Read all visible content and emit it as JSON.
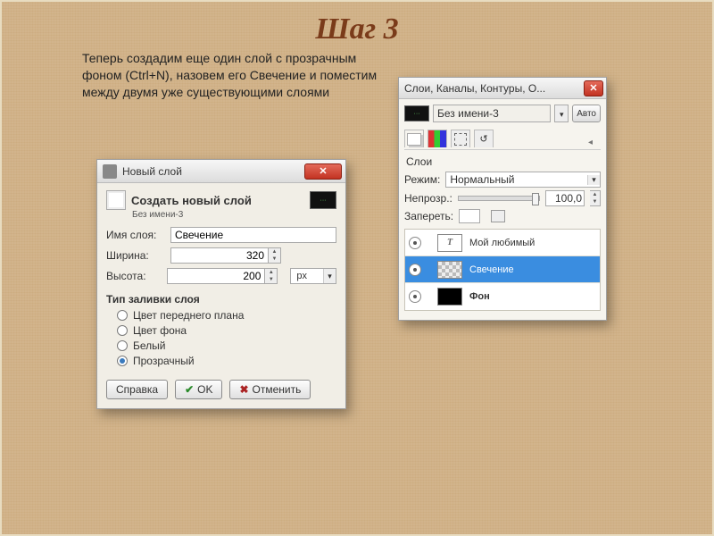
{
  "page": {
    "title": "Шаг 3",
    "instructions": "Теперь создадим еще один слой с прозрачным фоном  (Ctrl+N), назовем его Свечение и  поместим между двумя уже существующими слоями"
  },
  "newLayerDialog": {
    "windowTitle": "Новый слой",
    "heading": "Создать новый слой",
    "imageName": "Без имени-3",
    "labels": {
      "name": "Имя слоя:",
      "width": "Ширина:",
      "height": "Высота:",
      "unit": "px"
    },
    "values": {
      "name": "Свечение",
      "width": "320",
      "height": "200"
    },
    "fillTitle": "Тип заливки слоя",
    "fillOptions": {
      "foreground": "Цвет переднего плана",
      "background": "Цвет фона",
      "white": "Белый",
      "transparent": "Прозрачный"
    },
    "buttons": {
      "help": "Справка",
      "ok": "OK",
      "cancel": "Отменить"
    }
  },
  "layersDock": {
    "windowTitle": "Слои, Каналы, Контуры, О...",
    "imageName": "Без имени-3",
    "autoLabel": "Авто",
    "sectionTitle": "Слои",
    "modeLabel": "Режим:",
    "modeValue": "Нормальный",
    "opacityLabel": "Непрозр.:",
    "opacityValue": "100,0",
    "lockLabel": "Запереть:",
    "layers": [
      {
        "name": "Мой любимый",
        "thumbStyle": "text",
        "selected": false
      },
      {
        "name": "Свечение",
        "thumbStyle": "checker",
        "selected": true
      },
      {
        "name": "Фон",
        "thumbStyle": "black",
        "selected": false,
        "bold": true
      }
    ]
  }
}
